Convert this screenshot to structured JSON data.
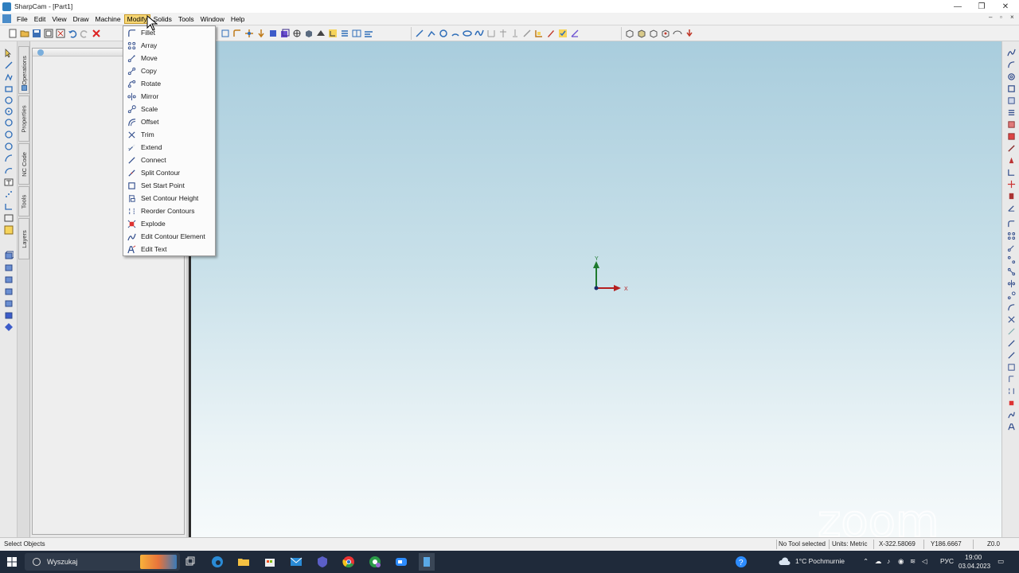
{
  "window": {
    "title": "SharpCam - [Part1]",
    "min": "—",
    "max": "❐",
    "close": "✕"
  },
  "menubar": {
    "items": [
      "File",
      "Edit",
      "View",
      "Draw",
      "Machine",
      "Modify",
      "Solids",
      "Tools",
      "Window",
      "Help"
    ],
    "active": "Modify"
  },
  "modify_menu": {
    "items": [
      {
        "label": "Fillet",
        "icon": "fillet-icon"
      },
      {
        "label": "Array",
        "icon": "array-icon"
      },
      {
        "label": "Move",
        "icon": "move-icon"
      },
      {
        "label": "Copy",
        "icon": "copy-icon"
      },
      {
        "label": "Rotate",
        "icon": "rotate-icon"
      },
      {
        "label": "Mirror",
        "icon": "mirror-icon"
      },
      {
        "label": "Scale",
        "icon": "scale-icon"
      },
      {
        "label": "Offset",
        "icon": "offset-icon"
      },
      {
        "label": "Trim",
        "icon": "trim-icon"
      },
      {
        "label": "Extend",
        "icon": "extend-icon"
      },
      {
        "label": "Connect",
        "icon": "connect-icon"
      },
      {
        "label": "Split Contour",
        "icon": "split-contour-icon"
      },
      {
        "label": "Set Start Point",
        "icon": "set-start-point-icon"
      },
      {
        "label": "Set Contour Height",
        "icon": "set-contour-height-icon"
      },
      {
        "label": "Reorder Contours",
        "icon": "reorder-contours-icon"
      },
      {
        "label": "Explode",
        "icon": "explode-icon"
      },
      {
        "label": "Edit Contour Element",
        "icon": "edit-contour-element-icon"
      },
      {
        "label": "Edit Text",
        "icon": "edit-text-icon"
      }
    ]
  },
  "vertical_tabs": [
    "Operations",
    "Properties",
    "NC Code",
    "Tools",
    "Layers"
  ],
  "axis": {
    "x_label": "X",
    "y_label": "Y"
  },
  "statusbar": {
    "left": "Select Objects",
    "tool": "No Tool selected",
    "units": "Units: Metric",
    "x": "X-322.58069",
    "y": "Y186.6667",
    "z": "Z0.0"
  },
  "taskbar": {
    "search_placeholder": "Wyszukaj",
    "weather": "1°C  Pochmurnie",
    "lang": "РУС",
    "time": "19:00",
    "date": "03.04.2023"
  },
  "watermark": "zoom",
  "colors": {
    "menu_highlight": "#f7d774",
    "canvas_top": "#a9cddd",
    "canvas_bottom": "#f6fafb",
    "taskbar": "#1f2a3a"
  }
}
